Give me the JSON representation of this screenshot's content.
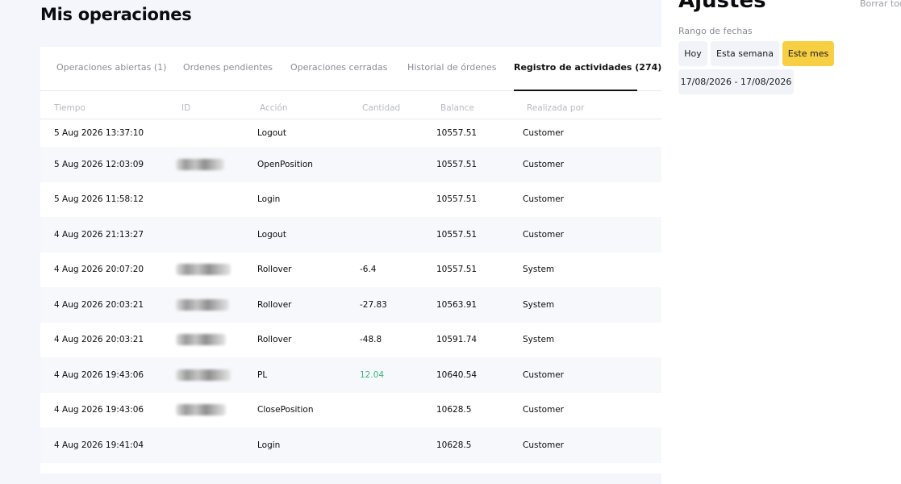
{
  "header": {
    "title": "Mis operaciones"
  },
  "tabs": [
    {
      "label": "Operaciones abiertas (1)"
    },
    {
      "label": "Ordenes pendientes"
    },
    {
      "label": "Operaciones cerradas"
    },
    {
      "label": "Historial de órdenes"
    },
    {
      "label": "Registro de actividades (274)",
      "active": true
    }
  ],
  "table": {
    "columns": [
      "Tiempo",
      "ID",
      "Acción",
      "Cantidad",
      "Balance",
      "Realizada por"
    ],
    "rows": [
      {
        "time": "5 Aug 2026 13:37:10",
        "id_redacted": false,
        "action": "Logout",
        "amount": "",
        "balance": "10557.51",
        "by": "Customer"
      },
      {
        "time": "5 Aug 2026 12:03:09",
        "id_redacted": true,
        "action": "OpenPosition",
        "amount": "",
        "balance": "10557.51",
        "by": "Customer"
      },
      {
        "time": "5 Aug 2026 11:58:12",
        "id_redacted": false,
        "action": "Login",
        "amount": "",
        "balance": "10557.51",
        "by": "Customer"
      },
      {
        "time": "4 Aug 2026 21:13:27",
        "id_redacted": false,
        "action": "Logout",
        "amount": "",
        "balance": "10557.51",
        "by": "Customer"
      },
      {
        "time": "4 Aug 2026 20:07:20",
        "id_redacted": true,
        "action": "Rollover",
        "amount": "-6.4",
        "balance": "10557.51",
        "by": "System"
      },
      {
        "time": "4 Aug 2026 20:03:21",
        "id_redacted": true,
        "action": "Rollover",
        "amount": "-27.83",
        "balance": "10563.91",
        "by": "System"
      },
      {
        "time": "4 Aug 2026 20:03:21",
        "id_redacted": true,
        "action": "Rollover",
        "amount": "-48.8",
        "balance": "10591.74",
        "by": "System"
      },
      {
        "time": "4 Aug 2026 19:43:06",
        "id_redacted": true,
        "action": "PL",
        "amount": "12.04",
        "amount_positive": true,
        "balance": "10640.54",
        "by": "Customer"
      },
      {
        "time": "4 Aug 2026 19:43:06",
        "id_redacted": true,
        "action": "ClosePosition",
        "amount": "",
        "balance": "10628.5",
        "by": "Customer"
      },
      {
        "time": "4 Aug 2026 19:41:04",
        "id_redacted": false,
        "action": "Login",
        "amount": "",
        "balance": "10628.5",
        "by": "Customer"
      }
    ]
  },
  "settings": {
    "title": "Ajustes",
    "clear_label": "Borrar todo",
    "date_range_label": "Rango de fechas",
    "quick_ranges": [
      {
        "label": "Hoy"
      },
      {
        "label": "Esta semana"
      },
      {
        "label": "Este mes",
        "selected": true
      }
    ],
    "date_range_value": "17/08/2026 - 17/08/2026"
  },
  "colors": {
    "accent": "#f7cf42",
    "positive": "#3cb97a",
    "background": "#f4f6fc"
  }
}
